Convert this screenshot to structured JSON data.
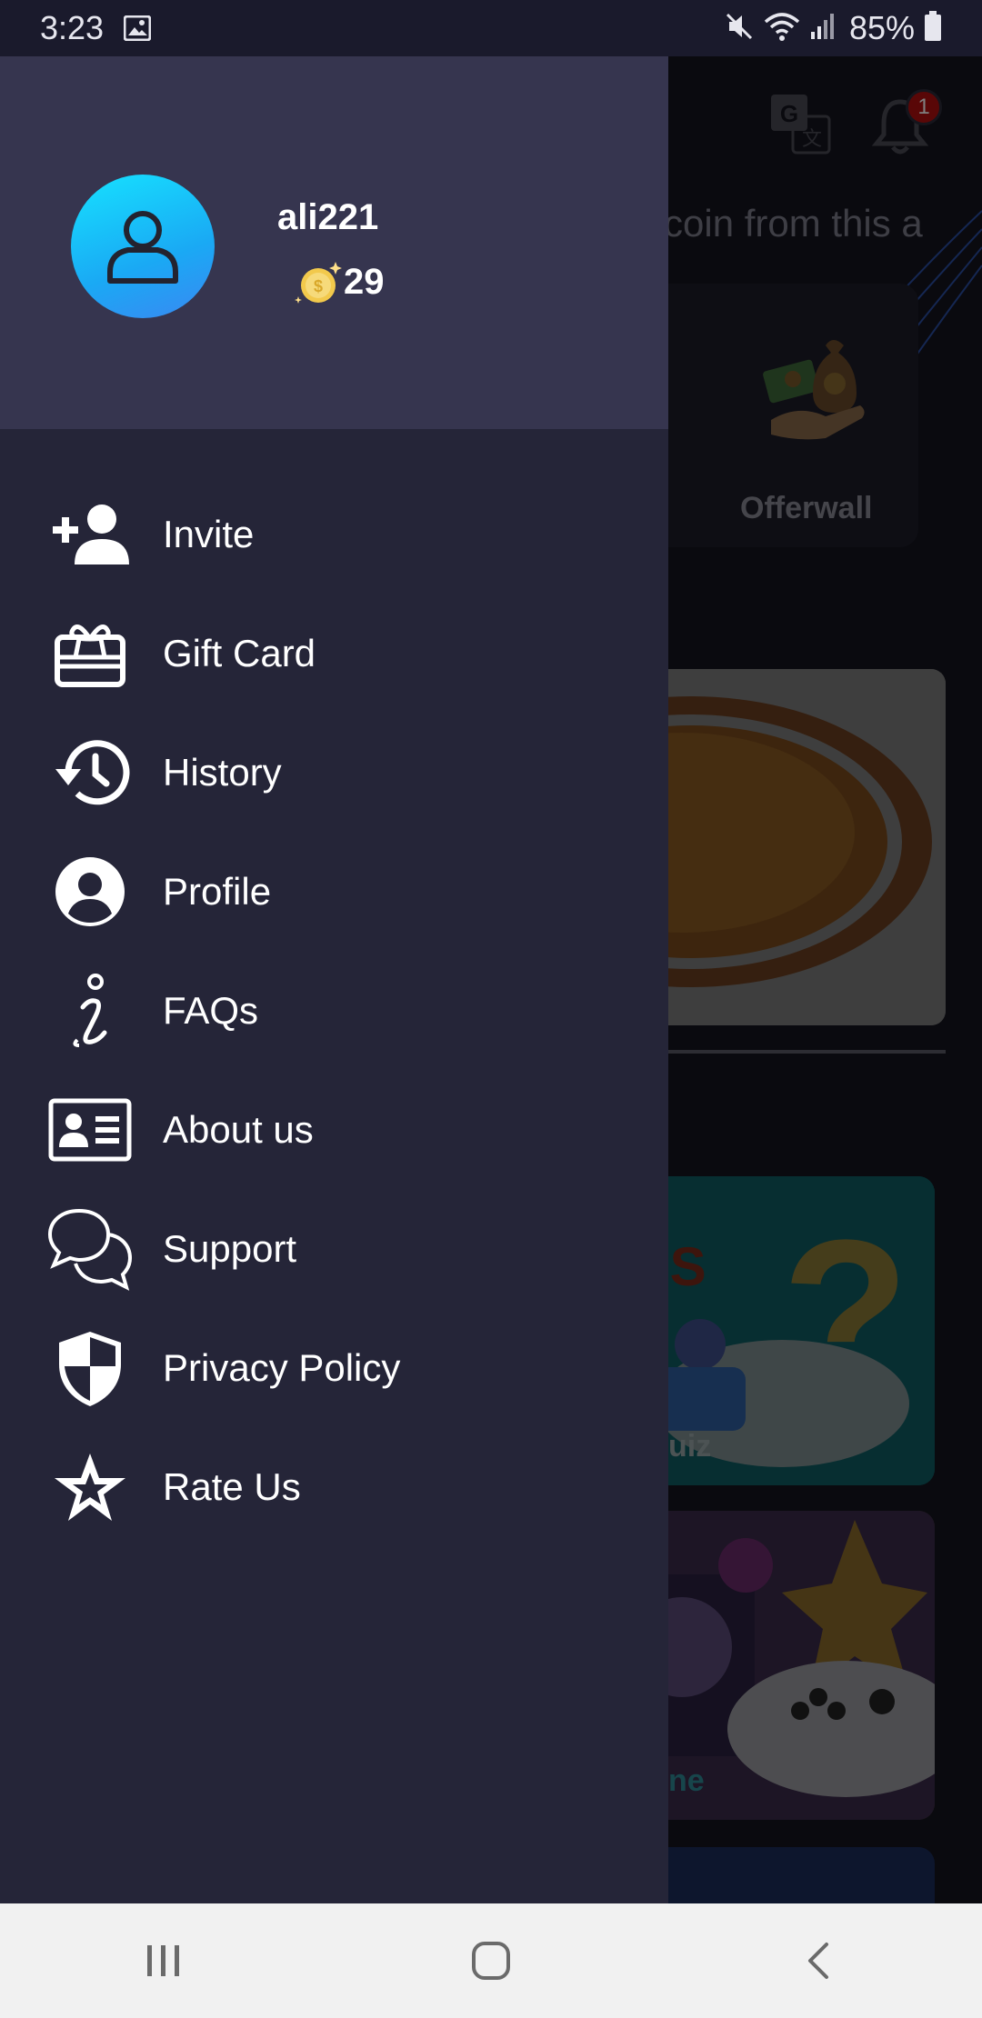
{
  "status_bar": {
    "time": "3:23",
    "battery": "85%"
  },
  "background": {
    "marquee_text": "coin from this a",
    "card_partial_label": "s",
    "offerwall_label": "Offerwall",
    "notification_count": "1",
    "quiz_label": "uiz",
    "game_label": "ne"
  },
  "drawer": {
    "username": "ali221",
    "coins": "29",
    "items": [
      {
        "label": "Invite",
        "icon": "add-user-icon"
      },
      {
        "label": "Gift Card",
        "icon": "gift-card-icon"
      },
      {
        "label": "History",
        "icon": "history-icon"
      },
      {
        "label": "Profile",
        "icon": "profile-icon"
      },
      {
        "label": "FAQs",
        "icon": "info-icon"
      },
      {
        "label": "About us",
        "icon": "id-card-icon"
      },
      {
        "label": "Support",
        "icon": "chat-bubbles-icon"
      },
      {
        "label": "Privacy Policy",
        "icon": "shield-icon"
      },
      {
        "label": "Rate Us",
        "icon": "star-icon"
      }
    ]
  },
  "colors": {
    "drawer_bg": "#252538",
    "drawer_header_bg": "#36354f",
    "avatar_gradient_start": "#16e2ff",
    "avatar_gradient_end": "#3a88f2",
    "badge": "#b20e0e"
  }
}
